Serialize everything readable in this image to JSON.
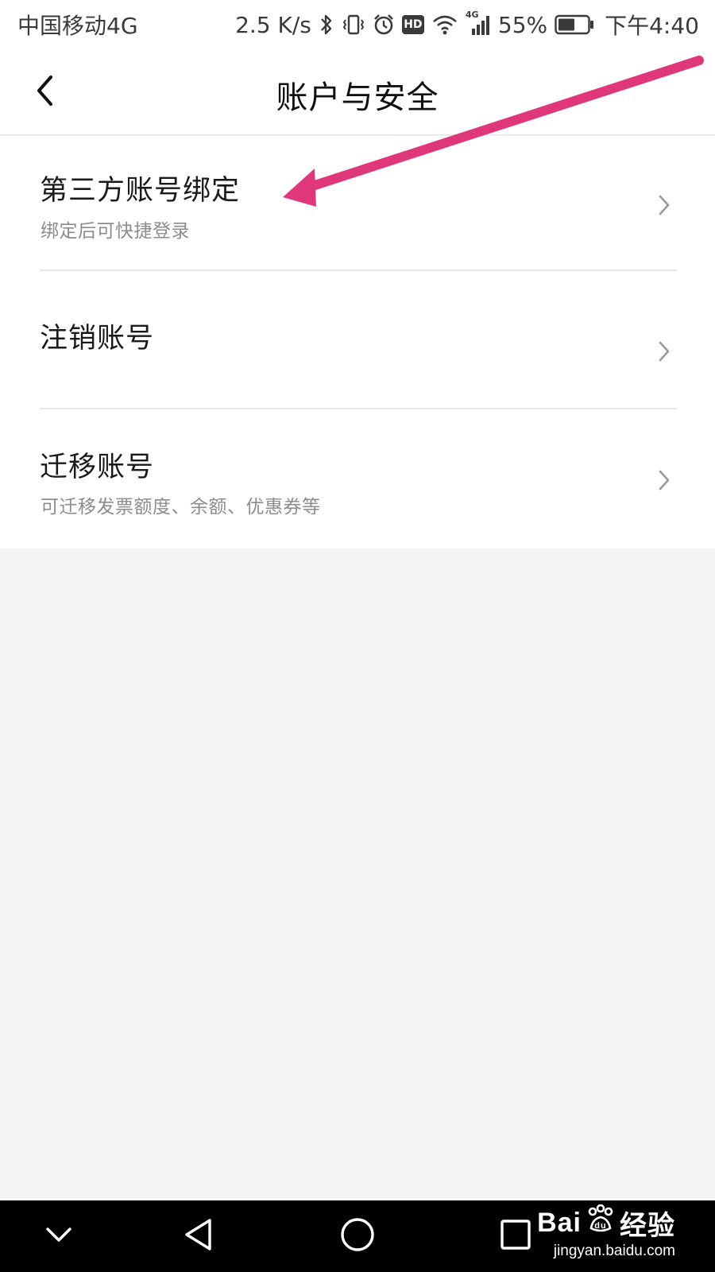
{
  "status_bar": {
    "carrier": "中国移动4G",
    "speed": "2.5 K/s",
    "network_badge": "HD",
    "cell_badge": "4G",
    "battery": "55%",
    "time": "下午4:40",
    "icons": [
      "bluetooth-icon",
      "vibrate-icon",
      "alarm-icon",
      "hd-icon",
      "wifi-icon",
      "signal-icon",
      "battery-icon"
    ]
  },
  "header": {
    "title": "账户与安全",
    "back_icon": "chevron-left-icon"
  },
  "list": {
    "items": [
      {
        "title": "第三方账号绑定",
        "subtitle": "绑定后可快捷登录"
      },
      {
        "title": "注销账号",
        "subtitle": ""
      },
      {
        "title": "迁移账号",
        "subtitle": "可迁移发票额度、余额、优惠券等"
      }
    ]
  },
  "annotation": {
    "color": "#e0377a"
  },
  "nav_bar": {
    "buttons": [
      "chevron-down-icon",
      "back-triangle-icon",
      "home-circle-icon",
      "recents-square-icon"
    ]
  },
  "watermark": {
    "logo_left": "Bai",
    "logo_right": "经验",
    "url": "jingyan.baidu.com"
  },
  "colors": {
    "background": "#f4f4f4",
    "card": "#ffffff",
    "title_text": "#1a1a1a",
    "subtitle_text": "#8c8c8c",
    "chevron": "#9a9a9a",
    "nav_bar": "#000000"
  }
}
